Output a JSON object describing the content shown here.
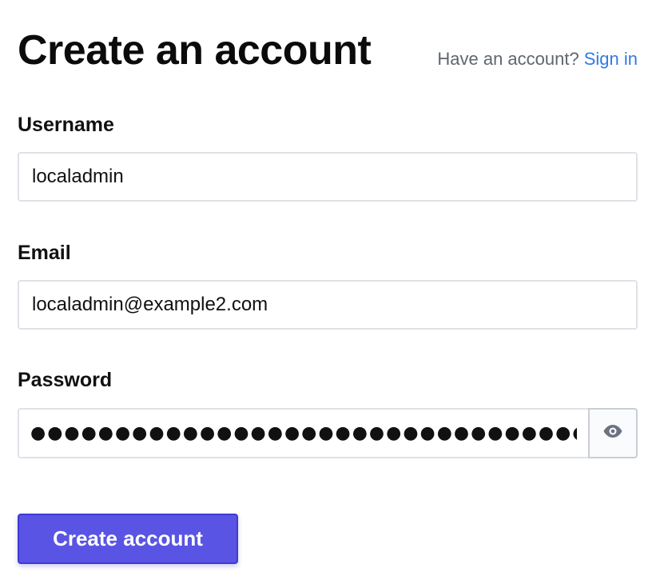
{
  "header": {
    "title": "Create an account",
    "signin_prompt": "Have an account?",
    "signin_link": "Sign in"
  },
  "form": {
    "username": {
      "label": "Username",
      "value": "localadmin"
    },
    "email": {
      "label": "Email",
      "value": "localadmin@example2.com"
    },
    "password": {
      "label": "Password",
      "masked_value": "●●●●●●●●●●●●●●●●●●●●●●●●●●●●●●●●●●●●●●●●●●●●●●●●●●●●●●●●●●●●●●●●●●●●●●●●●●",
      "reveal_icon": "eye-icon"
    },
    "submit_label": "Create account"
  },
  "colors": {
    "link": "#2f7be5",
    "primary_button": "#5a54e4",
    "primary_button_border": "#3f3ad7",
    "input_border": "#dfe2e7",
    "muted_text": "#5f6670"
  }
}
